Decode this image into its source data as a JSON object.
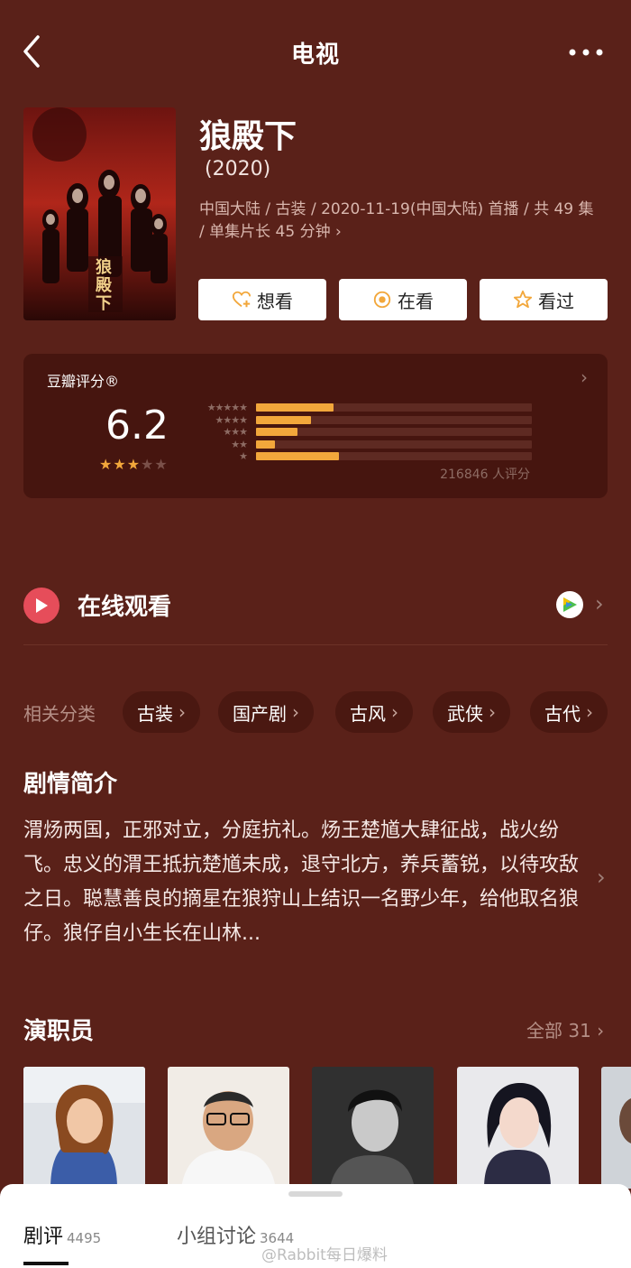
{
  "header": {
    "title": "电视"
  },
  "show": {
    "name": "狼殿下",
    "year": "(2020)",
    "meta": "中国大陆 / 古装 / 2020-11-19(中国大陆) 首播 / 共 49 集 / 单集片长 45 分钟 ›",
    "poster_text": "狼殿下"
  },
  "actions": [
    {
      "label": "想看",
      "icon": "heart-plus-icon"
    },
    {
      "label": "在看",
      "icon": "target-icon"
    },
    {
      "label": "看过",
      "icon": "star-outline-icon"
    }
  ],
  "rating": {
    "label": "豆瓣评分®",
    "score": "6.2",
    "stars_filled": 3,
    "stars_total": 5,
    "count_text": "216846 人评分",
    "distribution": [
      {
        "stars": "★★★★★",
        "fraction": 0.28
      },
      {
        "stars": "★★★★",
        "fraction": 0.2
      },
      {
        "stars": "★★★",
        "fraction": 0.15
      },
      {
        "stars": "★★",
        "fraction": 0.07
      },
      {
        "stars": "★",
        "fraction": 0.3
      }
    ],
    "bar_color": "#f2a73b"
  },
  "online": {
    "label": "在线观看"
  },
  "categories": {
    "label": "相关分类",
    "items": [
      "古装",
      "国产剧",
      "古风",
      "武侠",
      "古代"
    ]
  },
  "synopsis": {
    "title": "剧情简介",
    "text": "渭炀两国，正邪对立，分庭抗礼。炀王楚馗大肆征战，战火纷飞。忠义的渭王抵抗楚馗未成，退守北方，养兵蓄锐，以待攻敌之日。聪慧善良的摘星在狼狩山上结识一名野少年，给他取名狼仔。狼仔自小生长在山林..."
  },
  "cast": {
    "title": "演职员",
    "all_label": "全部 31 ›"
  },
  "bottom_tabs": [
    {
      "label": "剧评",
      "count": "4495"
    },
    {
      "label": "小组讨论",
      "count": "3644"
    }
  ],
  "watermark": "@Rabbit每日爆料"
}
